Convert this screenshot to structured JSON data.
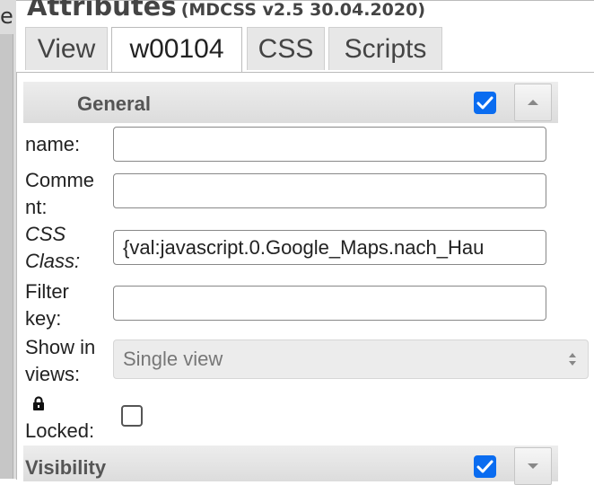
{
  "header": {
    "title": "Attributes",
    "version": "(MDCSS v2.5 30.04.2020)",
    "left_cut_text": "e"
  },
  "tabs": [
    {
      "label": "View",
      "active": false
    },
    {
      "label": "w00104",
      "active": true
    },
    {
      "label": "CSS",
      "active": false
    },
    {
      "label": "Scripts",
      "active": false
    }
  ],
  "general": {
    "title": "General",
    "enabled": true,
    "collapse_icon": "chevron-up-icon",
    "fields": {
      "name": {
        "label": "name:",
        "value": ""
      },
      "comment": {
        "label_1": "Comme",
        "label_2": "nt:",
        "value": ""
      },
      "css_class": {
        "label_1": "CSS",
        "label_2": "Class:",
        "value": "{val:javascript.0.Google_Maps.nach_Hau"
      },
      "filter_key": {
        "label_1": "Filter",
        "label_2": "key:",
        "value": ""
      },
      "show_in_views": {
        "label_1": "Show in",
        "label_2": "views:",
        "value": "Single view"
      },
      "locked": {
        "label": "Locked:",
        "checked": false,
        "icon": "lock-icon"
      }
    }
  },
  "visibility": {
    "title": "Visibility",
    "enabled": true,
    "expand_icon": "chevron-down-icon"
  },
  "colors": {
    "accent": "#0a6cf0",
    "header_bg": "#e3e3e3"
  }
}
